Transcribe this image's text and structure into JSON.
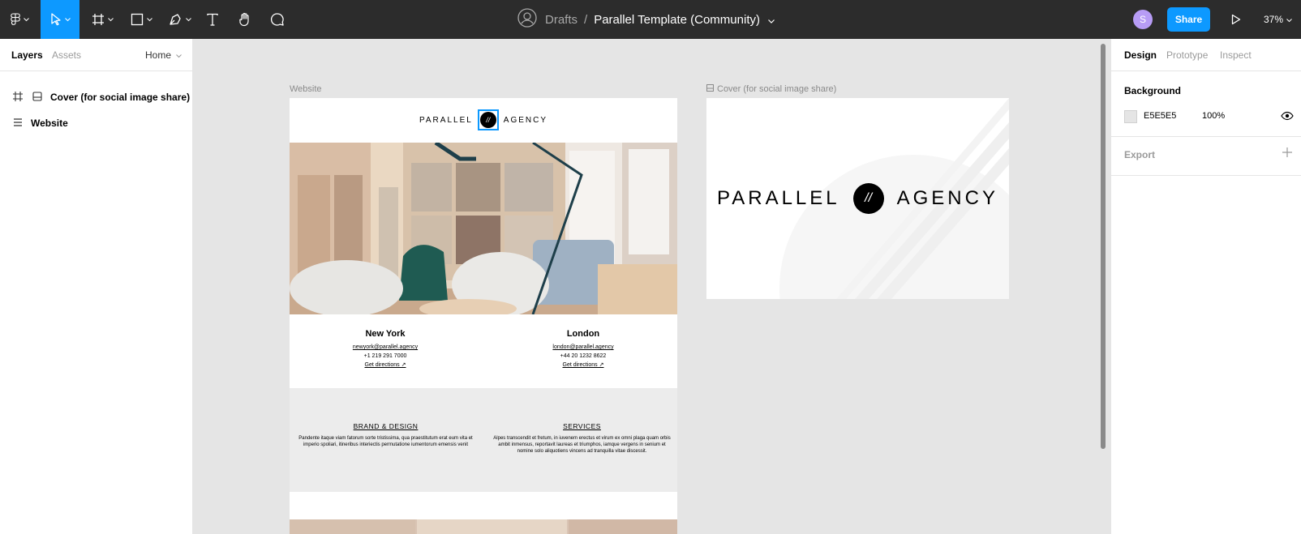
{
  "toolbar": {
    "breadcrumb": {
      "team": "Drafts",
      "separator": "/",
      "file_name": "Parallel Template (Community)"
    },
    "share_label": "Share",
    "avatar_initial": "S",
    "zoom": "37%",
    "active_tool": "move"
  },
  "layers_panel": {
    "tabs": [
      "Layers",
      "Assets"
    ],
    "page": "Home",
    "layers": [
      {
        "label": "Cover (for social image share)",
        "icon": "frame-icon"
      },
      {
        "label": "Website",
        "icon": "frame-icon"
      }
    ]
  },
  "canvas": {
    "website_frame": {
      "label": "Website",
      "logo": {
        "left": "PARALLEL",
        "mark": "//",
        "right": "AGENCY"
      },
      "offices": [
        {
          "city": "New York",
          "email": "newyork@parallel.agency",
          "phone": "+1 219 291 7000",
          "directions": "Get directions ↗"
        },
        {
          "city": "London",
          "email": "london@parallel.agency",
          "phone": "+44 20 1232 8622",
          "directions": "Get directions ↗"
        }
      ],
      "services": [
        {
          "title": "BRAND & DESIGN",
          "text": "Pandente itaque viam fatorum sorte tristissima, qua praestitutum erat eum vita et imperio spoliari, itineribus interiectis permutatione iumentorum emensis venit"
        },
        {
          "title": "SERVICES",
          "text": "Alpes transcendit et fretum, in iuvenem erectus et virum ex omni plaga quam orbis ambit inmensus, reportavit laureas et triumphos, iamque vergens in senium et nomine solo aliquotiens vincens ad tranquilla vitae discessit."
        }
      ]
    },
    "cover_frame": {
      "label": "Cover (for social image share)",
      "logo": {
        "left": "PARALLEL",
        "mark": "//",
        "right": "AGENCY"
      }
    }
  },
  "design_panel": {
    "tabs": [
      "Design",
      "Prototype",
      "Inspect"
    ],
    "background": {
      "title": "Background",
      "hex": "E5E5E5",
      "opacity": "100%"
    },
    "export": {
      "title": "Export"
    }
  },
  "colors": {
    "accent": "#0d99ff",
    "toolbar": "#2c2c2c",
    "canvas": "#e5e5e5",
    "avatar": "#b79cf5"
  }
}
